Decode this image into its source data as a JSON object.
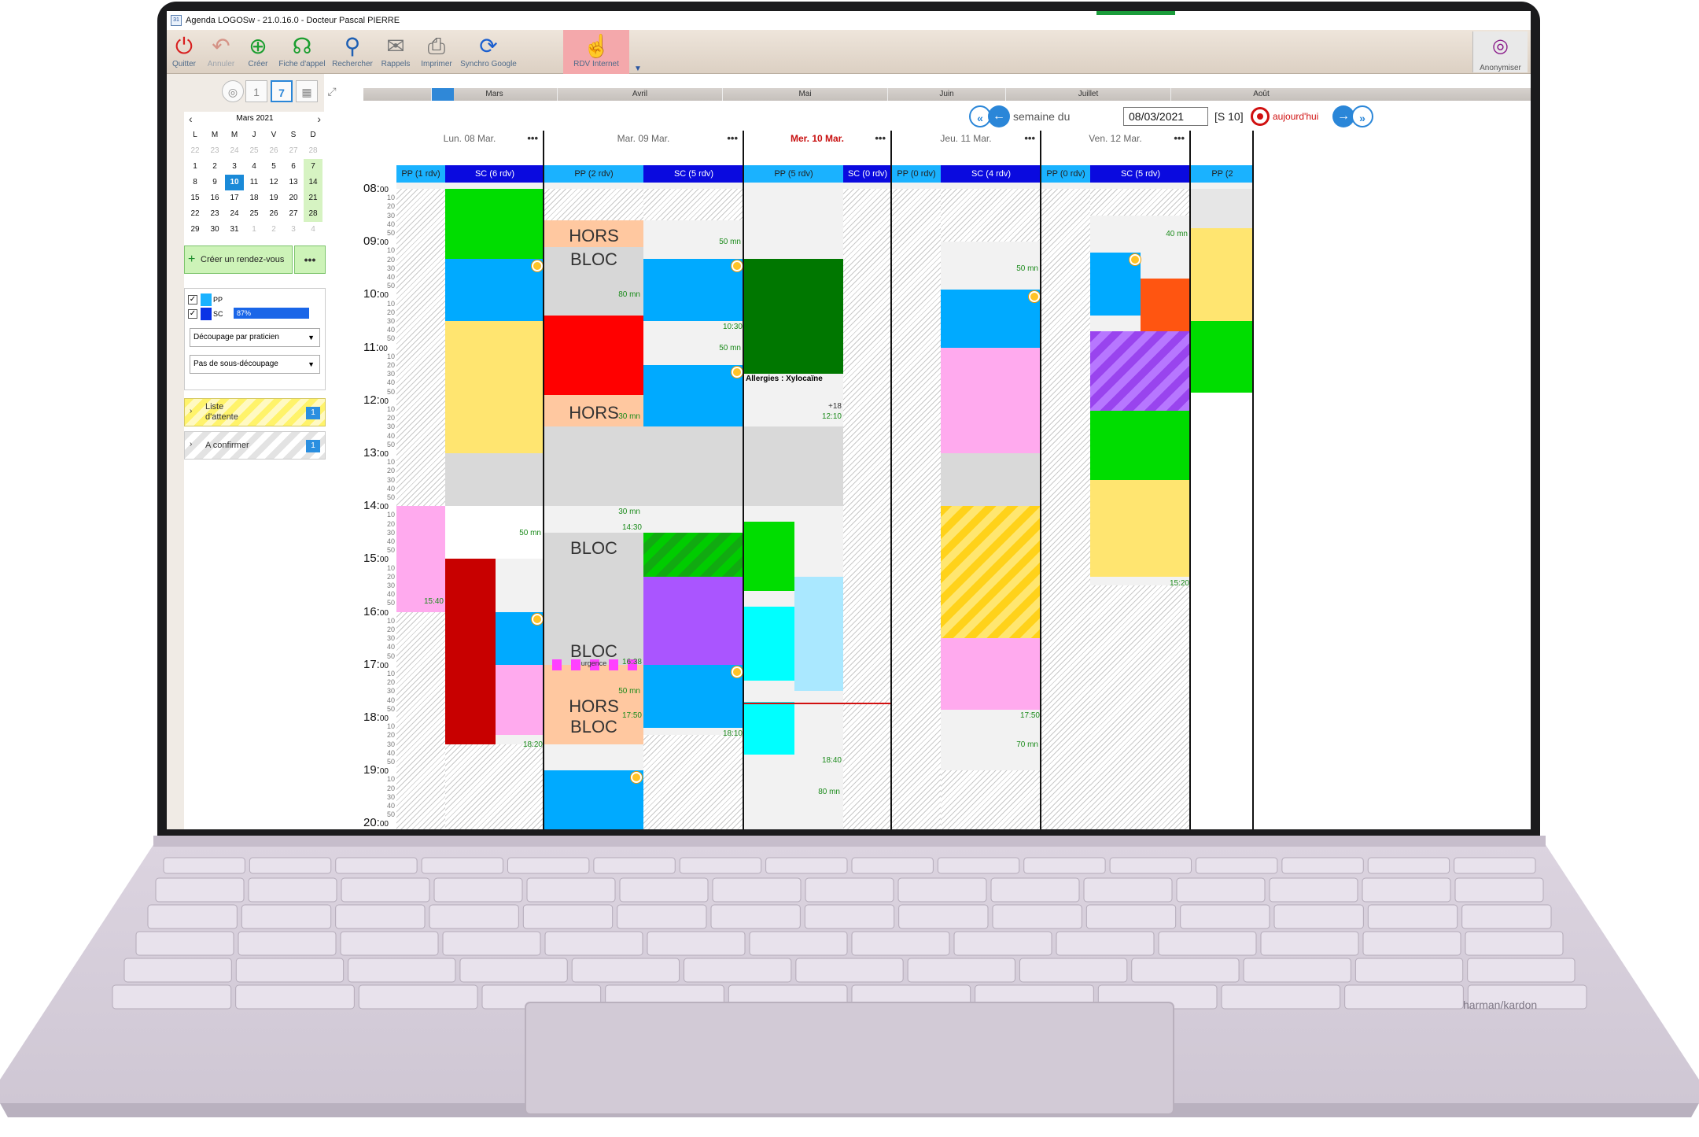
{
  "window": {
    "title": "Agenda LOGOSw - 21.0.16.0 - Docteur Pascal PIERRE"
  },
  "toolbar": {
    "quitter": "Quitter",
    "annuler": "Annuler",
    "creer": "Créer",
    "fiche_appel": "Fiche d'appel",
    "rechercher": "Rechercher",
    "rappels": "Rappels",
    "imprimer": "Imprimer",
    "synchro_google": "Synchro Google",
    "rdv_internet": "RDV Internet",
    "anonymiser": "Anonymiser"
  },
  "view_tabs": {
    "month_tab": "1",
    "week_tab": "7"
  },
  "minical": {
    "title": "Mars 2021",
    "dow": [
      "L",
      "M",
      "M",
      "J",
      "V",
      "S",
      "D"
    ],
    "weeks": [
      [
        "22",
        "23",
        "24",
        "25",
        "26",
        "27",
        "28"
      ],
      [
        "1",
        "2",
        "3",
        "4",
        "5",
        "6",
        "7"
      ],
      [
        "8",
        "9",
        "10",
        "11",
        "12",
        "13",
        "14"
      ],
      [
        "15",
        "16",
        "17",
        "18",
        "19",
        "20",
        "21"
      ],
      [
        "22",
        "23",
        "24",
        "25",
        "26",
        "27",
        "28"
      ],
      [
        "29",
        "30",
        "31",
        "1",
        "2",
        "3",
        "4"
      ]
    ],
    "selected": "10"
  },
  "sidebar": {
    "create_label": "Créer un rendez-vous",
    "more_label": "•••",
    "legend": [
      {
        "name": "PP",
        "color": "#1ab2ff"
      },
      {
        "name": "SC",
        "color": "#0a33e6",
        "pct": "87%"
      }
    ],
    "select1": "Découpage par praticien",
    "select2": "Pas de sous-découpage",
    "wait_label": "Liste d'attente",
    "wait_line1": "Liste",
    "wait_line2": "d'attente",
    "wait_count": "1",
    "confirm_label": "A confirmer",
    "confirm_count": "1"
  },
  "months_bar": [
    "Mars",
    "Avril",
    "Mai",
    "Juin",
    "Juillet",
    "Août"
  ],
  "nav": {
    "label": "semaine du",
    "date": "08/03/2021",
    "week": "[S 10]",
    "today": "aujourd'hui"
  },
  "hours": [
    "08:",
    "09:",
    "10:",
    "11:",
    "12:",
    "13:",
    "14:",
    "15:",
    "16:",
    "17:",
    "18:",
    "19:",
    "20:"
  ],
  "hour_suffix": "00",
  "quarters": [
    "10",
    "20",
    "30",
    "40",
    "50"
  ],
  "days": [
    {
      "label": "Lun. 08 Mar.",
      "today": false,
      "pp": "PP (1 rdv)",
      "sc": "SC (6 rdv)"
    },
    {
      "label": "Mar. 09 Mar.",
      "today": false,
      "pp": "PP (2 rdv)",
      "sc": "SC (5 rdv)"
    },
    {
      "label": "Mer. 10 Mar.",
      "today": true,
      "pp": "PP (5 rdv)",
      "sc": "SC (0 rdv)"
    },
    {
      "label": "Jeu. 11 Mar.",
      "today": false,
      "pp": "PP (0 rdv)",
      "sc": "SC (4 rdv)"
    },
    {
      "label": "Ven. 12 Mar.",
      "today": false,
      "pp": "PP (0 rdv)",
      "sc": "SC (5 rdv)"
    },
    {
      "label": "",
      "today": false,
      "pp": "PP (2",
      "sc": ""
    }
  ],
  "texts": {
    "hors_bloc": "HORS BLOC",
    "bloc": "BLOC",
    "urgence": "urgence",
    "allergies": "Allergies : Xylocaïne",
    "plus18": "+18",
    "t_1540": "15:40",
    "t_50mn": "50 mn",
    "t_1820": "18:20",
    "t_80mn": "80 mn",
    "t_30mn": "30 mn",
    "t_1430": "14:30",
    "t_1638": "16:38",
    "t_1750": "17:50",
    "t_1030": "10:30",
    "t_1810": "18:10",
    "t_1210": "12:10",
    "t_1840": "18:40",
    "t_70mn": "70 mn",
    "t_40mn": "40 mn",
    "t_1520": "15:20"
  }
}
